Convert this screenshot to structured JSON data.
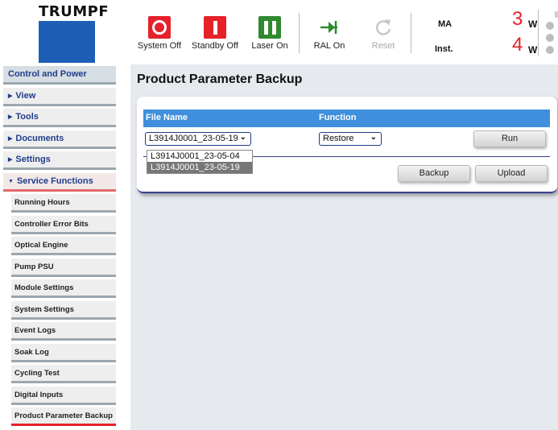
{
  "logo": {
    "text": "TRUMPF",
    "color": "#1e5fb6"
  },
  "toolbar": {
    "system_off": "System Off",
    "standby_off": "Standby Off",
    "laser_on": "Laser On",
    "ral_on": "RAL On",
    "reset": "Reset"
  },
  "status": {
    "ma_label": "MA",
    "inst_label": "Inst.",
    "value1": "3",
    "unit1": "W",
    "value2": "4",
    "unit2": "W"
  },
  "sidebar": {
    "header": "Control and Power",
    "groups": [
      "View",
      "Tools",
      "Documents",
      "Settings",
      "Service Functions"
    ],
    "sub_items": [
      "Running Hours",
      "Controller Error Bits",
      "Optical Engine",
      "Pump PSU",
      "Module Settings",
      "System Settings",
      "Event Logs",
      "Soak Log",
      "Cycling Test",
      "Digital Inputs",
      "Product Parameter Backup"
    ]
  },
  "main": {
    "title": "Product Parameter Backup",
    "col_file": "File Name",
    "col_function": "Function",
    "file_selected": "L3914J0001_23-05-19",
    "file_options": [
      "L3914J0001_23-05-04",
      "L3914J0001_23-05-19"
    ],
    "function_selected": "Restore",
    "run": "Run",
    "backup": "Backup",
    "upload": "Upload"
  },
  "colors": {
    "accent_red": "#e52129",
    "accent_green": "#2f8a2f",
    "table_header": "#3f8fdc"
  },
  "icons": [
    "power-off-icon",
    "standby-icon",
    "laser-on-icon",
    "ral-arrow-icon",
    "reset-icon"
  ]
}
